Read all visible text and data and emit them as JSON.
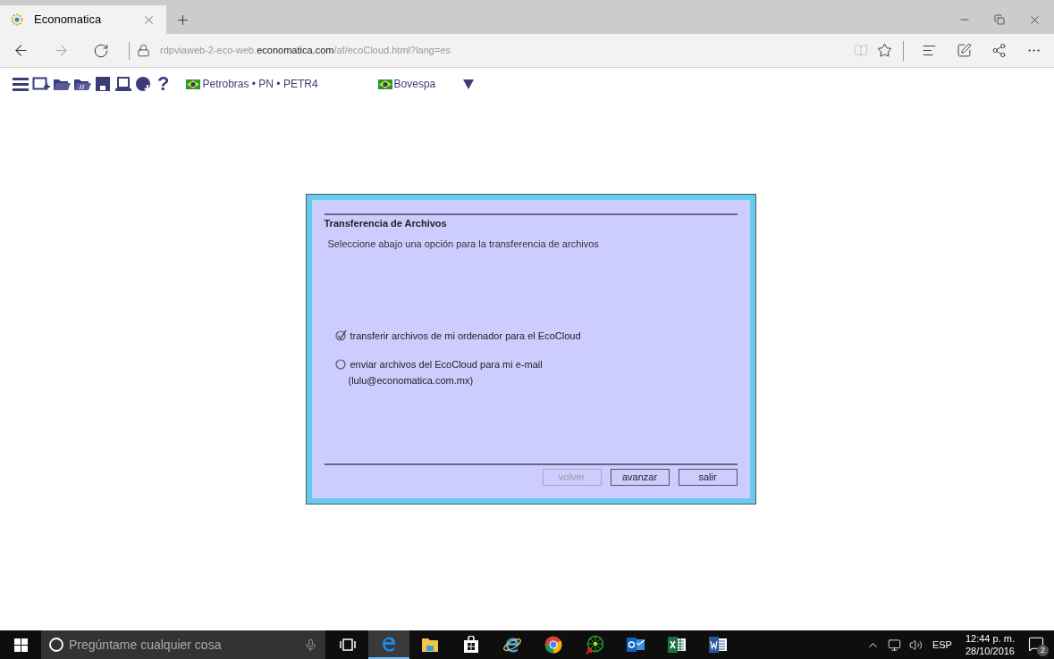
{
  "browser": {
    "tabs": [
      {
        "title": "Economatica",
        "selected": true
      }
    ],
    "url": {
      "prefix": "rdpviaweb-2-eco-web.",
      "domain": "economatica.com",
      "suffix": "/af/ecoCloud.html?lang=es"
    }
  },
  "toolbar": {
    "tools": [
      {
        "kind": "menu"
      },
      {
        "kind": "new"
      },
      {
        "kind": "open"
      },
      {
        "kind": "open-formula"
      },
      {
        "kind": "save"
      },
      {
        "kind": "screen"
      },
      {
        "kind": "download"
      }
    ],
    "help": "?",
    "security": "Petrobras • PN • PETR4",
    "exchange": "Bovespa"
  },
  "dialog": {
    "title": "Transferencia de Archivos",
    "instruction": "Seleccione abajo una opción para la transferencia de archivos",
    "options": [
      {
        "label": "transferir archivos de mi ordenador para el EcoCloud",
        "selected": true
      },
      {
        "label": "enviar archivos del EcoCloud para mi e-mail",
        "detail": "(lulu@economatica.com.mx)",
        "selected": false
      }
    ],
    "buttons": [
      {
        "label": "volver",
        "disabled": true
      },
      {
        "label": "avanzar",
        "disabled": false
      },
      {
        "label": "salir",
        "disabled": false
      }
    ]
  },
  "taskbar": {
    "search_placeholder": "Pregúntame cualquier cosa",
    "apps": [
      {
        "kind": "task-view",
        "selected": false
      },
      {
        "kind": "edge",
        "selected": true
      },
      {
        "kind": "explorer",
        "selected": false
      },
      {
        "kind": "store",
        "selected": false
      },
      {
        "kind": "ie",
        "selected": false
      },
      {
        "kind": "chrome",
        "selected": false
      },
      {
        "kind": "radar",
        "selected": false
      },
      {
        "kind": "outlook",
        "selected": false
      },
      {
        "kind": "excel",
        "selected": false
      },
      {
        "kind": "word",
        "selected": false
      }
    ],
    "language": "ESP",
    "time": "12:44 p. m.",
    "date": "28/10/2016",
    "notifications": "2"
  }
}
